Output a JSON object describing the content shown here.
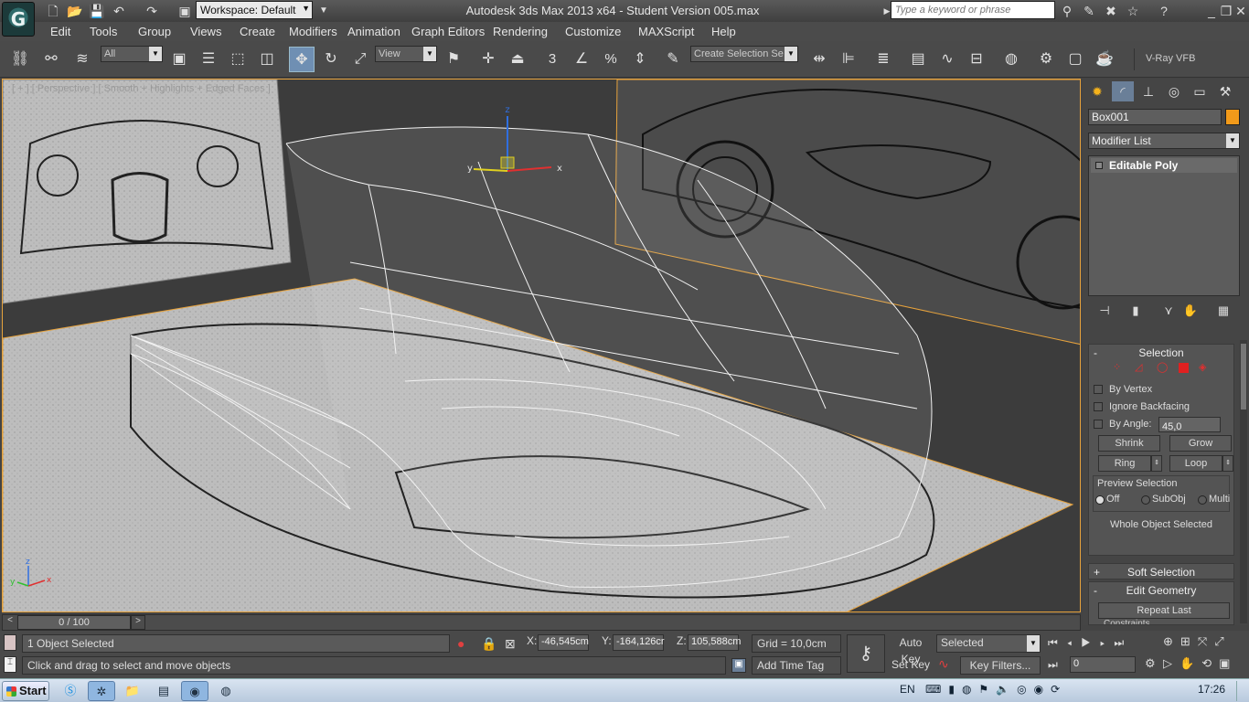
{
  "window": {
    "title": "Autodesk 3ds Max  2013 x64  -  Student Version     005.max",
    "workspace": "Workspace: Default",
    "search_placeholder": "Type a keyword or phrase",
    "logo_glyph": "G"
  },
  "menu": [
    "Edit",
    "Tools",
    "Group",
    "Views",
    "Create",
    "Modifiers",
    "Animation",
    "Graph Editors",
    "Rendering",
    "Customize",
    "MAXScript",
    "Help"
  ],
  "toolbar": {
    "filter": "All",
    "ref_coord": "View",
    "selection_set": "Create Selection Se",
    "vray": "V-Ray VFB",
    "snap_labels": [
      "3",
      "%"
    ],
    "select_move_icon": "move-icon"
  },
  "viewport": {
    "label": "[ + ] [ Perspective ] [ Smooth + Highlights + Edged Faces ]",
    "gizmo_axes": [
      "x",
      "y",
      "z"
    ],
    "corner_axes": [
      "x",
      "y",
      "z"
    ]
  },
  "command_panel": {
    "object_name": "Box001",
    "object_color": "#f29a1a",
    "modifier_list": "Modifier List",
    "stack": [
      "Editable Poly"
    ],
    "selection": {
      "title": "Selection",
      "by_vertex": "By Vertex",
      "ignore_backfacing": "Ignore Backfacing",
      "by_angle": "By Angle:",
      "angle_value": "45,0",
      "shrink": "Shrink",
      "grow": "Grow",
      "ring": "Ring",
      "loop": "Loop",
      "preview": "Preview Selection",
      "preview_off": "Off",
      "preview_subobj": "SubObj",
      "preview_multi": "Multi",
      "status": "Whole Object Selected"
    },
    "soft_selection": "Soft Selection",
    "edit_geometry": "Edit Geometry",
    "repeat_last": "Repeat Last",
    "constraints": "Constraints"
  },
  "timeslider": {
    "frame": "0 / 100"
  },
  "status": {
    "selected": "1 Object Selected",
    "prompt": "Click and drag to select and move objects",
    "x_label": "X:",
    "x": "-46,545cm",
    "y_label": "Y:",
    "y": "-164,126cr",
    "z_label": "Z:",
    "z": "105,588cm",
    "grid": "Grid = 10,0cm",
    "add_time_tag": "Add Time Tag",
    "auto_key": "Auto Key",
    "set_key": "Set Key",
    "key_mode": "Selected",
    "key_filters": "Key Filters...",
    "frame_field": "0"
  },
  "taskbar": {
    "start": "Start",
    "lang": "EN",
    "time": "17:26"
  }
}
